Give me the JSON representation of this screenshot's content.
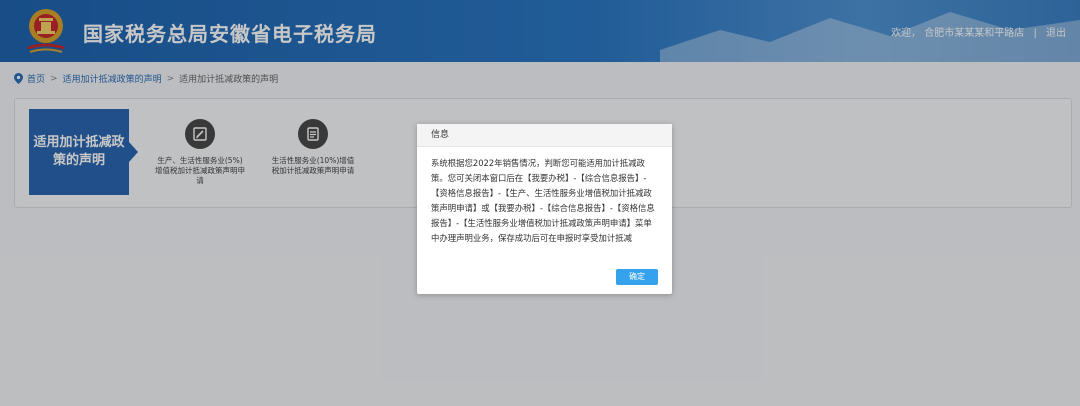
{
  "header": {
    "title": "国家税务总局安徽省电子税务局",
    "welcome": "欢迎，",
    "user": "合肥市某某某和平路店",
    "separator": "|",
    "logout": "退出",
    "emblem_icon": "tax-emblem-icon"
  },
  "breadcrumb": {
    "home": "首页",
    "arrow": ">",
    "parent": "适用加计抵减政策的声明",
    "current": "适用加计抵减政策的声明"
  },
  "panel": {
    "side_label": "适用加计抵减政策的声明",
    "tiles": [
      {
        "icon": "edit-document-icon",
        "caption": "生产、生活性服务业(5%)增值税加计抵减政策声明申请"
      },
      {
        "icon": "document-list-icon",
        "caption": "生活性服务业(10%)增值税加计抵减政策声明申请"
      }
    ]
  },
  "dialog": {
    "title": "信息",
    "message": "系统根据您2022年销售情况，判断您可能适用加计抵减政策。您可关闭本窗口后在【我要办税】-【综合信息报告】-【资格信息报告】-【生产、生活性服务业增值税加计抵减政策声明申请】或【我要办税】-【综合信息报告】-【资格信息报告】-【生活性服务业增值税加计抵减政策声明申请】菜单中办理声明业务，保存成功后可在申报时享受加计抵减",
    "ok_label": "确定"
  },
  "colors": {
    "header_blue": "#2b77c3",
    "side_label_blue": "#2a66b0",
    "ok_button": "#35a2ee"
  }
}
